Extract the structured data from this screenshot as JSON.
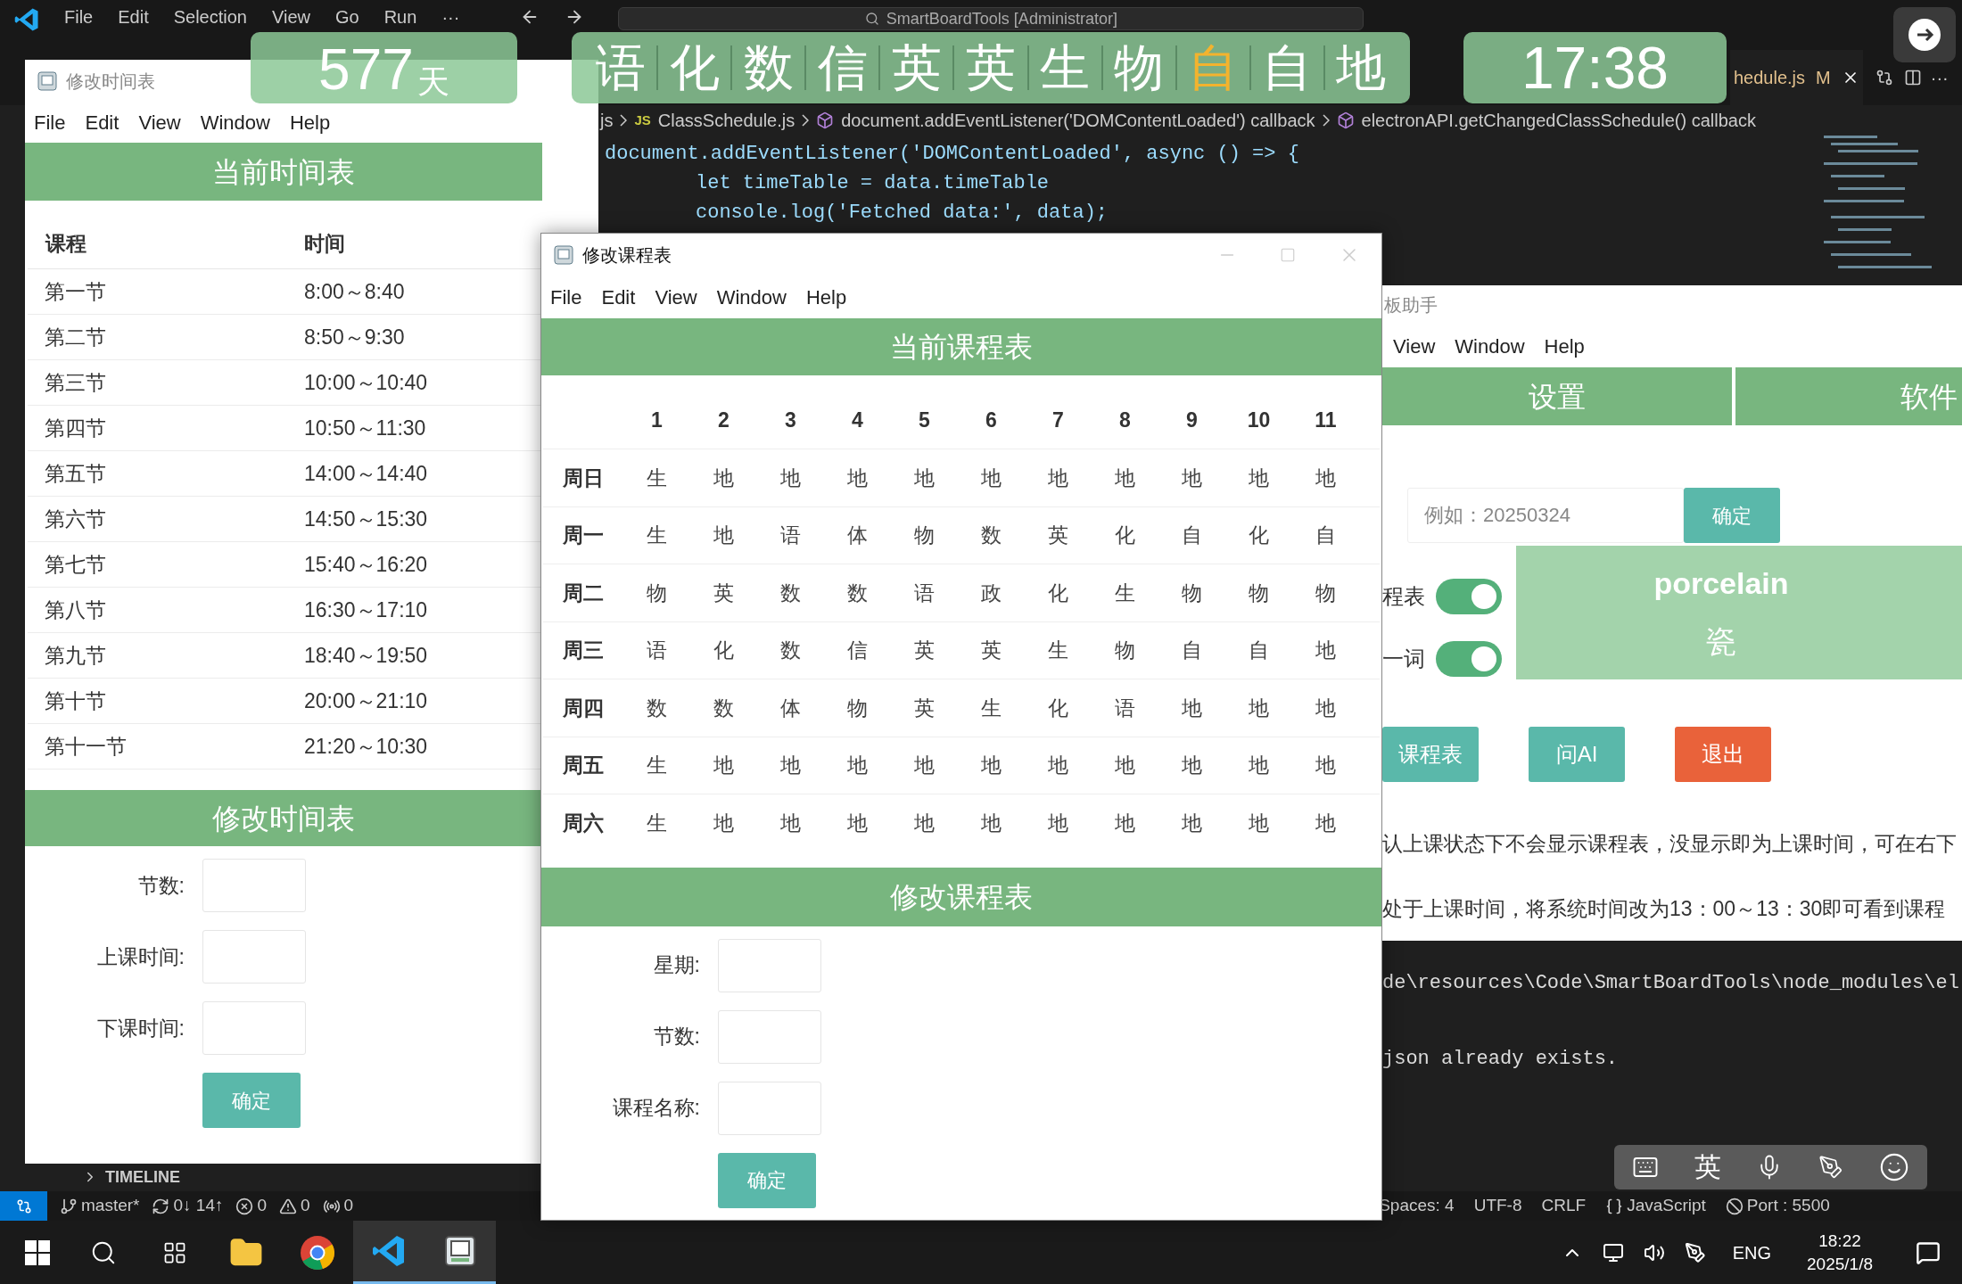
{
  "vscode": {
    "menu": [
      "File",
      "Edit",
      "Selection",
      "View",
      "Go",
      "Run",
      "···"
    ],
    "command_center": "SmartBoardTools [Administrator]",
    "tab": {
      "label": "hedule.js",
      "badge": "M",
      "selected": true
    },
    "more_actions": "···",
    "breadcrumb": [
      {
        "text": "js",
        "kind": "folder"
      },
      {
        "text": "ClassSchedule.js",
        "kind": "file",
        "icon_text": "JS"
      },
      {
        "text": "document.addEventListener('DOMContentLoaded') callback",
        "kind": "symbol"
      },
      {
        "text": "electronAPI.getChangedClassSchedule() callback",
        "kind": "symbol"
      }
    ],
    "code_lines": [
      "document.addEventListener('DOMContentLoaded', async () => {",
      "let timeTable = data.timeTable",
      "console.log('Fetched data:', data);"
    ],
    "terminal_lines": [
      "de\\resources\\Code\\SmartBoardTools\\node_modules\\el",
      "json already exists."
    ],
    "timeline": "TIMELINE",
    "status_left": [
      {
        "kind": "branch",
        "text": "master*"
      },
      {
        "kind": "sync",
        "text": "0↓ 14↑"
      },
      {
        "kind": "errors",
        "text": "0"
      },
      {
        "kind": "warnings",
        "text": "0"
      },
      {
        "kind": "ports",
        "text": "0"
      }
    ],
    "status_right": [
      {
        "kind": "plain",
        "text": "Spaces: 4"
      },
      {
        "kind": "plain",
        "text": "UTF-8"
      },
      {
        "kind": "plain",
        "text": "CRLF"
      },
      {
        "kind": "language",
        "text": "JavaScript"
      },
      {
        "kind": "port",
        "text": "Port : 5500"
      }
    ]
  },
  "widgets": {
    "countdown": {
      "value": "577",
      "unit": "天"
    },
    "subjects": [
      {
        "text": "语",
        "current": false
      },
      {
        "text": "化",
        "current": false
      },
      {
        "text": "数",
        "current": false
      },
      {
        "text": "信",
        "current": false
      },
      {
        "text": "英",
        "current": false
      },
      {
        "text": "英",
        "current": false
      },
      {
        "text": "生",
        "current": false
      },
      {
        "text": "物",
        "current": false
      },
      {
        "text": "自",
        "current": true
      },
      {
        "text": "自",
        "current": false
      },
      {
        "text": "地",
        "current": false
      }
    ],
    "clock": "17:38"
  },
  "time_window": {
    "title": "修改时间表",
    "menu": [
      "File",
      "Edit",
      "View",
      "Window",
      "Help"
    ],
    "table_title": "当前时间表",
    "columns": [
      "课程",
      "时间"
    ],
    "rows": [
      [
        "第一节",
        "8:00～8:40"
      ],
      [
        "第二节",
        "8:50～9:30"
      ],
      [
        "第三节",
        "10:00～10:40"
      ],
      [
        "第四节",
        "10:50～11:30"
      ],
      [
        "第五节",
        "14:00～14:40"
      ],
      [
        "第六节",
        "14:50～15:30"
      ],
      [
        "第七节",
        "15:40～16:20"
      ],
      [
        "第八节",
        "16:30～17:10"
      ],
      [
        "第九节",
        "18:40～19:50"
      ],
      [
        "第十节",
        "20:00～21:10"
      ],
      [
        "第十一节",
        "21:20～10:30"
      ]
    ],
    "form_title": "修改时间表",
    "fields": [
      "节数:",
      "上课时间:",
      "下课时间:"
    ],
    "submit": "确定"
  },
  "schedule_window": {
    "title": "修改课程表",
    "menu": [
      "File",
      "Edit",
      "View",
      "Window",
      "Help"
    ],
    "table_title": "当前课程表",
    "columns": [
      "1",
      "2",
      "3",
      "4",
      "5",
      "6",
      "7",
      "8",
      "9",
      "10",
      "11"
    ],
    "rows": [
      {
        "day": "周日",
        "cells": [
          "生",
          "地",
          "地",
          "地",
          "地",
          "地",
          "地",
          "地",
          "地",
          "地",
          "地"
        ]
      },
      {
        "day": "周一",
        "cells": [
          "生",
          "地",
          "语",
          "体",
          "物",
          "数",
          "英",
          "化",
          "自",
          "化",
          "自"
        ]
      },
      {
        "day": "周二",
        "cells": [
          "物",
          "英",
          "数",
          "数",
          "语",
          "政",
          "化",
          "生",
          "物",
          "物",
          "物"
        ]
      },
      {
        "day": "周三",
        "cells": [
          "语",
          "化",
          "数",
          "信",
          "英",
          "英",
          "生",
          "物",
          "自",
          "自",
          "地"
        ]
      },
      {
        "day": "周四",
        "cells": [
          "数",
          "数",
          "体",
          "物",
          "英",
          "生",
          "化",
          "语",
          "地",
          "地",
          "地"
        ]
      },
      {
        "day": "周五",
        "cells": [
          "生",
          "地",
          "地",
          "地",
          "地",
          "地",
          "地",
          "地",
          "地",
          "地",
          "地"
        ]
      },
      {
        "day": "周六",
        "cells": [
          "生",
          "地",
          "地",
          "地",
          "地",
          "地",
          "地",
          "地",
          "地",
          "地",
          "地"
        ]
      }
    ],
    "form_title": "修改课程表",
    "fields": [
      "星期:",
      "节数:",
      "课程名称:"
    ],
    "submit": "确定"
  },
  "helper_window": {
    "title": "板助手",
    "menu": [
      "View",
      "Window",
      "Help"
    ],
    "tabs": [
      "设置",
      "软件"
    ],
    "date_placeholder": "例如：20250324",
    "confirm": "确定",
    "toggles": [
      {
        "label": "程表",
        "on": true
      },
      {
        "label": "一词",
        "on": true
      }
    ],
    "buttons": [
      {
        "label": "课程表",
        "kind": "primary"
      },
      {
        "label": "问AI",
        "kind": "primary"
      },
      {
        "label": "退出",
        "kind": "danger"
      }
    ],
    "notes": [
      "认上课状态下不会显示课程表，没显示即为上课时间，可在右下",
      "处于上课时间，将系统时间改为13：00～13：30即可看到课程"
    ],
    "word_popup": {
      "word": "porcelain",
      "meaning": "瓷"
    }
  },
  "ime_toolbar": {
    "mode": "英"
  },
  "taskbar": {
    "apps": [
      {
        "kind": "search",
        "active": false
      },
      {
        "kind": "taskview",
        "active": false
      },
      {
        "kind": "explorer",
        "active": false
      },
      {
        "kind": "chrome",
        "active": false
      },
      {
        "kind": "vscode",
        "active": true
      },
      {
        "kind": "app",
        "active": true
      }
    ],
    "language": "ENG",
    "time": "18:22",
    "date": "2025/1/8"
  }
}
